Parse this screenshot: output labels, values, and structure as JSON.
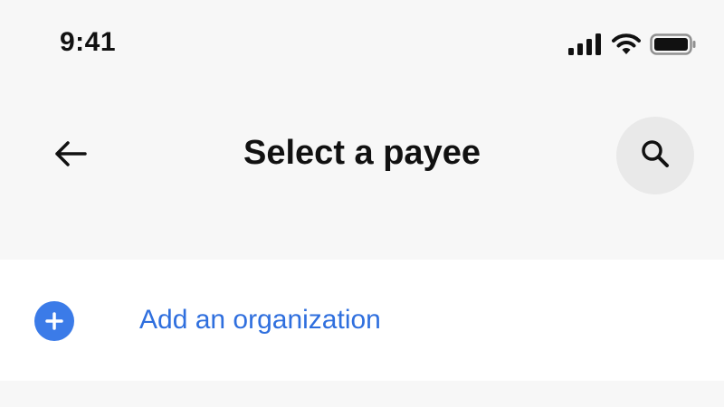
{
  "status_bar": {
    "time": "9:41",
    "icons": [
      "cellular-signal-icon",
      "wifi-icon",
      "battery-icon"
    ]
  },
  "header": {
    "title": "Select a payee",
    "back_icon": "back-arrow-icon",
    "search_icon": "search-icon"
  },
  "list": {
    "items": [
      {
        "label": "Add an organization",
        "icon": "plus-circle-icon"
      }
    ]
  },
  "colors": {
    "background": "#f7f7f7",
    "surface": "#ffffff",
    "accent": "#3b7be8",
    "link_text": "#2f6fde",
    "search_button_bg": "#e9e9e9",
    "text": "#111111"
  }
}
